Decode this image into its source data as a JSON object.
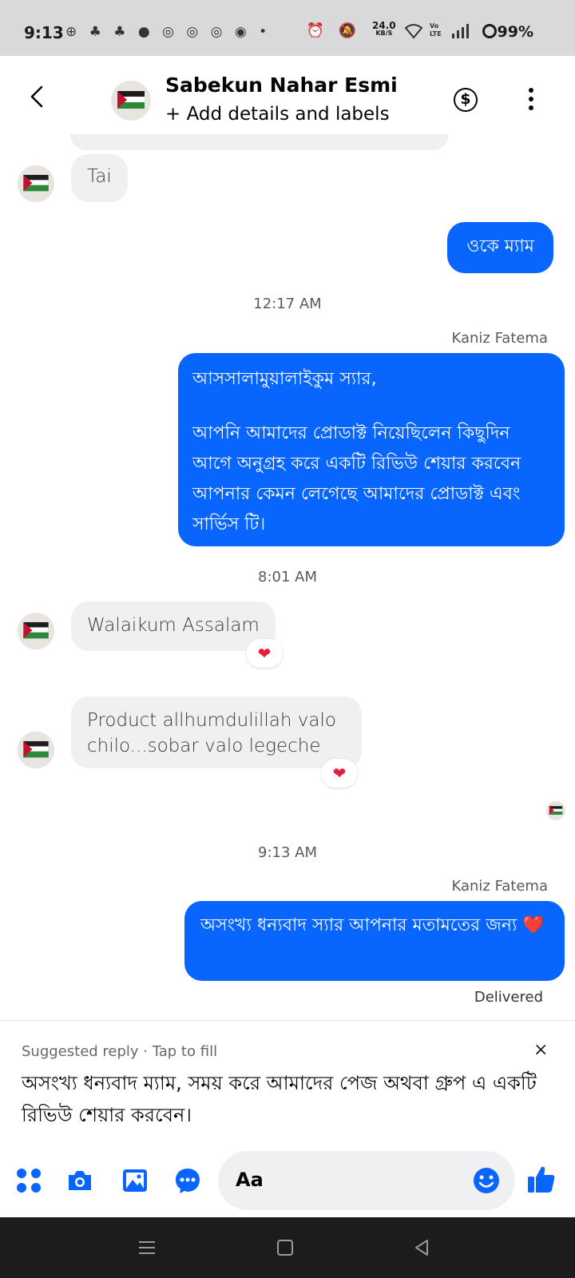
{
  "status_bar": {
    "time": "9:13",
    "left_icons": "⊕ ♣ ♣ ● ◎ ◎ ◎ ◉ •",
    "right_icons": "⏰ 🔕",
    "speed_top": "24.0",
    "speed_bottom": "KB/S",
    "network": "Vo LTE",
    "battery": "99%"
  },
  "header": {
    "name": "Sabekun Nahar Esmi",
    "subtitle": "+ Add details and labels",
    "dollar_symbol": "$"
  },
  "messages": {
    "m1": "Tai",
    "m2": "ওকে ম্যাম",
    "ts1": "12:17 AM",
    "sender1": "Kaniz Fatema",
    "m3_line1": "আসসালামুয়ালাইকুম স্যার,",
    "m3_line2": " আপনি আমাদের প্রোডাক্ট নিয়েছিলেন কিছুদিন আগে অনুগ্রহ করে একটি রিভিউ শেয়ার করবেন আপনার কেমন লেগেছে আমাদের প্রোডাক্ট এবং সার্ভিস টি।",
    "ts2": "8:01 AM",
    "m4": "Walaikum Assalam",
    "m5": "Product allhumdulillah valo chilo...sobar valo legeche",
    "ts3": "9:13 AM",
    "sender2": "Kaniz Fatema",
    "m6": "অসংখ্য ধন্যবাদ স্যার আপনার মতামতের জন্য ❤️",
    "heart": "❤",
    "delivered": "Delivered"
  },
  "suggested": {
    "label": "Suggested reply · Tap to fill",
    "close": "×",
    "text": "অসংখ্য ধন্যবাদ ম্যাম, সময় করে আমাদের পেজ অথবা গ্রুপ এ একটি রিভিউ শেয়ার করবেন।"
  },
  "composer": {
    "placeholder": "Aa"
  },
  "colors": {
    "accent": "#0866ff",
    "incoming_bubble": "#f0f0f2",
    "heart": "#e41e3f"
  }
}
